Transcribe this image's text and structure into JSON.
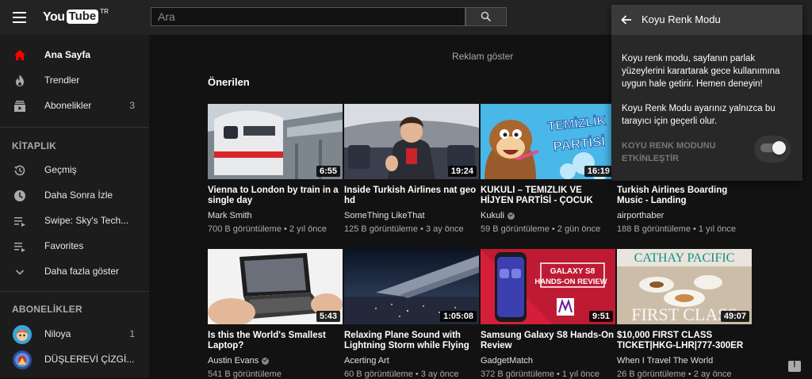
{
  "header": {
    "logo_you": "You",
    "logo_tube": "Tube",
    "logo_region": "TR",
    "search_placeholder": "Ara"
  },
  "sidebar": {
    "main_items": [
      {
        "label": "Ana Sayfa",
        "icon": "home-icon",
        "active": true
      },
      {
        "label": "Trendler",
        "icon": "flame-icon"
      },
      {
        "label": "Abonelikler",
        "icon": "subscriptions-icon",
        "count": "3"
      }
    ],
    "library_title": "KİTAPLIK",
    "library_items": [
      {
        "label": "Geçmiş",
        "icon": "history-icon"
      },
      {
        "label": "Daha Sonra İzle",
        "icon": "clock-icon"
      },
      {
        "label": "Swipe: Sky's Tech...",
        "icon": "playlist-icon"
      },
      {
        "label": "Favorites",
        "icon": "playlist-icon"
      },
      {
        "label": "Daha fazla göster",
        "icon": "chevron-down-icon"
      }
    ],
    "subs_title": "ABONELİKLER",
    "subs_items": [
      {
        "label": "Niloya",
        "count": "1"
      },
      {
        "label": "DÜŞLEREVİ ÇİZGİ..."
      }
    ]
  },
  "main": {
    "ad_text": "Reklam göster",
    "section_title": "Önerilen",
    "videos": [
      {
        "title": "Vienna to London by train in a single day",
        "channel": "Mark Smith",
        "verified": false,
        "meta": "700 B görüntüleme • 2 yıl önce",
        "duration": "6:55"
      },
      {
        "title": "Inside Turkish Airlines nat geo hd",
        "channel": "SomeThing LikeThat",
        "verified": false,
        "meta": "125 B görüntüleme • 3 ay önce",
        "duration": "19:24"
      },
      {
        "title": "KUKULİ – TEMİZLİK VE HİJYEN PARTİSİ - ÇOCUK",
        "channel": "Kukuli",
        "verified": true,
        "meta": "59 B görüntüleme • 2 gün önce",
        "duration": "16:19",
        "thumb_text1": "TEMİZLİK",
        "thumb_text2": "PARTİSİ"
      },
      {
        "title": "Turkish Airlines Boarding Music - Landing",
        "channel": "airporthaber",
        "verified": false,
        "meta": "188 B görüntüleme • 1 yıl önce",
        "duration": ""
      },
      {
        "title": "Is this the World's Smallest Laptop?",
        "channel": "Austin Evans",
        "verified": true,
        "meta": "541 B görüntüleme",
        "duration": "5:43"
      },
      {
        "title": "Relaxing Plane Sound with Lightning Storm while Flying",
        "channel": "Acerting Art",
        "verified": false,
        "meta": "60 B görüntüleme • 3 ay önce",
        "duration": "1:05:08"
      },
      {
        "title": "Samsung Galaxy S8 Hands-On Review",
        "channel": "GadgetMatch",
        "verified": false,
        "meta": "372 B görüntüleme • 1 yıl önce",
        "duration": "9:51",
        "thumb_text1": "GALAXY S8",
        "thumb_text2": "HANDS-ON REVIEW"
      },
      {
        "title": "$10,000 FIRST CLASS TICKET|HKG-LHR|777-300ER",
        "channel": "When I Travel The World",
        "verified": false,
        "meta": "26 B görüntüleme • 2 ay önce",
        "duration": "49:07",
        "thumb_text1": "CATHAY PACIFIC",
        "thumb_text2": "FIRST CLASS"
      }
    ]
  },
  "popup": {
    "title": "Koyu Renk Modu",
    "p1": "Koyu renk modu, sayfanın parlak yüzeylerini karartarak gece kullanımına uygun hale getirir. Hemen deneyin!",
    "p2": "Koyu Renk Modu ayarınız yalnızca bu tarayıcı için geçerli olur.",
    "toggle_label": "KOYU RENK MODUNU ETKİNLEŞTİR",
    "toggle_on": true
  },
  "colors": {
    "background": "#121212",
    "header": "#232323",
    "sidebar": "#1c1c1c",
    "accent_red": "#ff0000",
    "popup": "#282828"
  }
}
